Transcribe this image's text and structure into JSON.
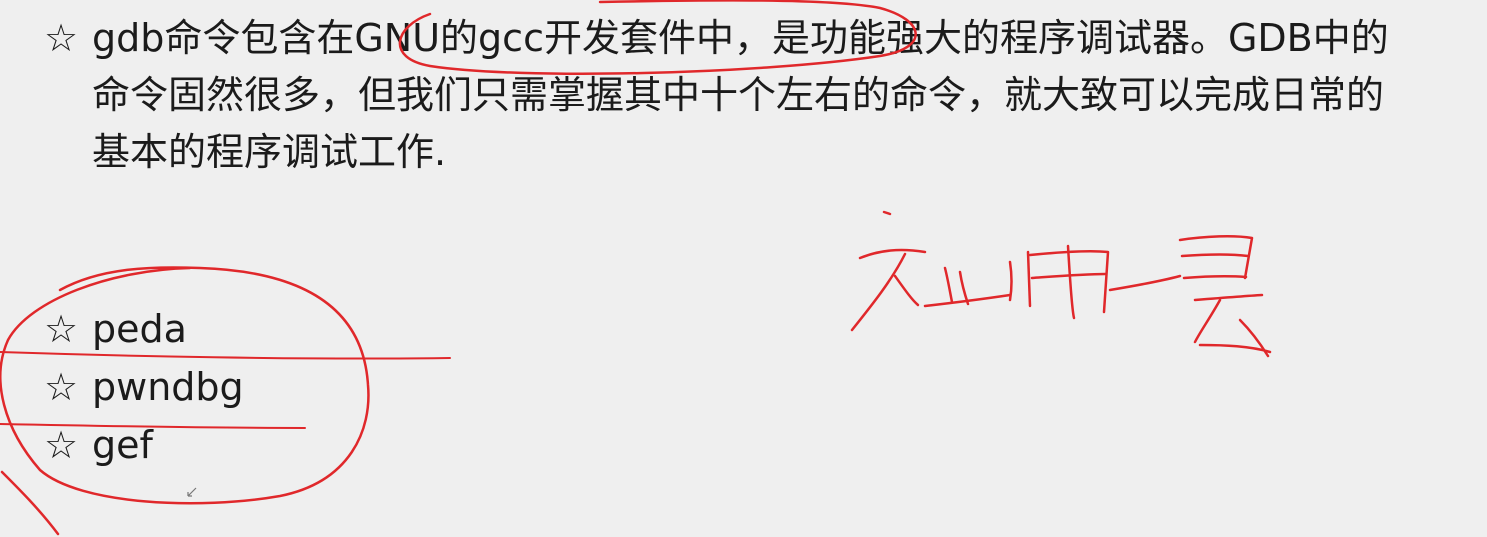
{
  "paragraph": {
    "star": "☆",
    "text": "gdb命令包含在GNU的gcc开发套件中，是功能强大的程序调试器。GDB中的命令固然很多，但我们只需掌握其中十个左右的命令，就大致可以完成日常的基本的程序调试工作."
  },
  "bullets": [
    {
      "star": "☆",
      "label": "peda"
    },
    {
      "star": "☆",
      "label": "pwndbg"
    },
    {
      "star": "☆",
      "label": "gef"
    }
  ],
  "annotation": {
    "ink_color": "#e0282b",
    "handwritten_note": "加用法"
  }
}
